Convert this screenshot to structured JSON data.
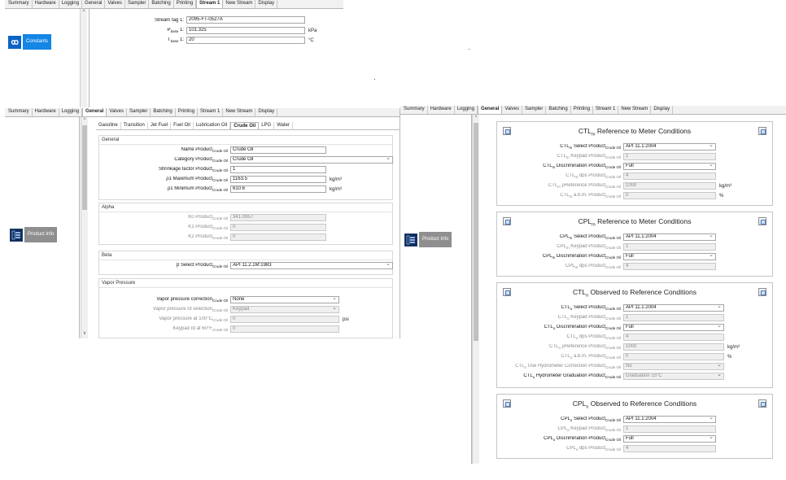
{
  "tabs": [
    "Summary",
    "Hardware",
    "Logging",
    "General",
    "Valves",
    "Sampler",
    "Batching",
    "Printing",
    "Stream 1",
    "New Stream",
    "Display"
  ],
  "top_panel": {
    "active_tab": "Stream 1",
    "tile_label": "Constants",
    "fields": [
      {
        "label": "Stream tag 1:",
        "value": "2095-FT-0527A",
        "unit": ""
      },
      {
        "label_main": "P",
        "label_sub": "base",
        "label_tail": " 1:",
        "value": "101.325",
        "unit": "kPa"
      },
      {
        "label_main": "T",
        "label_sub": "base",
        "label_tail": " 1:",
        "value": "20",
        "unit": "°C"
      }
    ]
  },
  "left_panel": {
    "active_tab": "General",
    "tile_label": "Product Info",
    "product_tabs": [
      "Gasoline",
      "Transition",
      "Jet Fuel",
      "Fuel Oil",
      "Lubrication Oil",
      "Crude Oil",
      "LPG",
      "Water"
    ],
    "active_product_tab": "Crude Oil",
    "general": {
      "title": "General",
      "rows": [
        {
          "label": "Name Product",
          "sub": "Crude Oil",
          "value": "Crude Oil",
          "kind": "input",
          "unit": ""
        },
        {
          "label": "Category Product",
          "sub": "Crude Oil",
          "value": "Crude Oil",
          "kind": "select",
          "unit": ""
        },
        {
          "label": "Shrinkage factor Product",
          "sub": "Crude Oil",
          "value": "1",
          "kind": "input",
          "unit": ""
        },
        {
          "label": "ρ1 Maximum Product",
          "sub": "Crude Oil",
          "value": "1163.5",
          "kind": "input",
          "unit": "kg/m³"
        },
        {
          "label": "ρ1 Minimum Product",
          "sub": "Crude Oil",
          "value": "610.6",
          "kind": "input",
          "unit": "kg/m³"
        }
      ]
    },
    "alpha": {
      "title": "Alpha",
      "rows": [
        {
          "label": "K0 Product",
          "sub": "Crude Oil",
          "value": "341.0957"
        },
        {
          "label": "K1 Product",
          "sub": "Crude Oil",
          "value": "0"
        },
        {
          "label": "K2 Product",
          "sub": "Crude Oil",
          "value": "0"
        }
      ]
    },
    "beta": {
      "title": "Beta",
      "label": "β Select Product",
      "sub": "Crude Oil",
      "value": "API 11.2.1M:1983"
    },
    "vapor": {
      "title": "Vapor Pressure",
      "rows": [
        {
          "label": "Vapor pressure correction",
          "sub": "Crude Oil",
          "value": "None",
          "kind": "select",
          "dim": false,
          "unit": ""
        },
        {
          "label": "Vapor pressure rd selection",
          "sub": "Crude Oil",
          "value": "Keypad",
          "kind": "select-dis",
          "dim": true,
          "unit": ""
        },
        {
          "label": "Vapor pressure at 100°C",
          "sub": "Crude Oil",
          "value": "0",
          "kind": "input-dis",
          "dim": true,
          "unit": "psi"
        },
        {
          "label": "Keypad rd at 60°F",
          "sub": "Crude Oil",
          "value": "0",
          "kind": "input-dis",
          "dim": true,
          "unit": ""
        }
      ]
    }
  },
  "right_panel": {
    "active_tab": "General",
    "tile_label": "Product Info",
    "cards": [
      {
        "title_main": "CTL",
        "title_sub": "m",
        "title_tail": " Reference to Meter Conditions",
        "rows": [
          {
            "pre": "CTL",
            "psub": "m",
            "label": " Select Product",
            "sub": "Crude Oil",
            "value": "API 11.1:2004",
            "kind": "select",
            "dim": false,
            "unit": ""
          },
          {
            "pre": "CTL",
            "psub": "m",
            "label": " Keypad Product",
            "sub": "Crude Oil",
            "value": "1",
            "kind": "input-dis",
            "dim": true,
            "unit": ""
          },
          {
            "pre": "CTL",
            "psub": "m",
            "label": " Discrimination Product",
            "sub": "Crude Oil",
            "value": "Full",
            "kind": "select",
            "dim": false,
            "unit": ""
          },
          {
            "pre": "CTL",
            "psub": "m",
            "label": " dps Product",
            "sub": "Crude Oil",
            "value": "4",
            "kind": "input-dis",
            "dim": true,
            "unit": ""
          },
          {
            "pre": "CTL",
            "psub": "m",
            "label": " ρReference Product",
            "sub": "Crude Oil",
            "value": "1000",
            "kind": "input-dis",
            "dim": true,
            "unit": "kg/m³"
          },
          {
            "pre": "CTL",
            "psub": "m",
            "label": " a.b.m. Product",
            "sub": "Crude Oil",
            "value": "0",
            "kind": "input-dis",
            "dim": true,
            "unit": "%"
          }
        ]
      },
      {
        "title_main": "CPL",
        "title_sub": "m",
        "title_tail": " Reference to Meter Conditions",
        "rows": [
          {
            "pre": "CPL",
            "psub": "m",
            "label": " Select Product",
            "sub": "Crude Oil",
            "value": "API 11.1:2004",
            "kind": "select",
            "dim": false,
            "unit": ""
          },
          {
            "pre": "CPL",
            "psub": "m",
            "label": " Keypad Product",
            "sub": "Crude Oil",
            "value": "1",
            "kind": "input-dis",
            "dim": true,
            "unit": ""
          },
          {
            "pre": "CPL",
            "psub": "m",
            "label": " Discrimination Product",
            "sub": "Crude Oil",
            "value": "Full",
            "kind": "select",
            "dim": false,
            "unit": ""
          },
          {
            "pre": "CPL",
            "psub": "m",
            "label": " dps Product",
            "sub": "Crude Oil",
            "value": "4",
            "kind": "input-dis",
            "dim": true,
            "unit": ""
          }
        ]
      },
      {
        "title_main": "CTL",
        "title_sub": "o",
        "title_tail": " Observed to Reference Conditions",
        "rows": [
          {
            "pre": "CTL",
            "psub": "o",
            "label": " Select Product",
            "sub": "Crude Oil",
            "value": "API 11.1:2004",
            "kind": "select",
            "dim": false,
            "unit": ""
          },
          {
            "pre": "CTL",
            "psub": "o",
            "label": " Keypad Product",
            "sub": "Crude Oil",
            "value": "1",
            "kind": "input-dis",
            "dim": true,
            "unit": ""
          },
          {
            "pre": "CTL",
            "psub": "o",
            "label": " Discrimination Product",
            "sub": "Crude Oil",
            "value": "Full",
            "kind": "select",
            "dim": false,
            "unit": ""
          },
          {
            "pre": "CTL",
            "psub": "o",
            "label": " dps Product",
            "sub": "Crude Oil",
            "value": "4",
            "kind": "input-dis",
            "dim": true,
            "unit": ""
          },
          {
            "pre": "CTL",
            "psub": "o",
            "label": " ρReference Product",
            "sub": "Crude Oil",
            "value": "1000",
            "kind": "input-dis",
            "dim": true,
            "unit": "kg/m³"
          },
          {
            "pre": "CTL",
            "psub": "o",
            "label": " a.b.m. Product",
            "sub": "Crude Oil",
            "value": "0",
            "kind": "input-dis",
            "dim": true,
            "unit": "%"
          },
          {
            "pre": "CTL",
            "psub": "o",
            "label": " Use Hydrometer Correction Product",
            "sub": "Crude Oil",
            "value": "No",
            "kind": "select-dis",
            "dim": true,
            "unit": ""
          },
          {
            "pre": "CTL",
            "psub": "o",
            "label": " Hydrometer Graduation Product",
            "sub": "Crude Oil",
            "value": "Graduation 15°C",
            "kind": "select-dis",
            "dim": false,
            "unit": ""
          }
        ]
      },
      {
        "title_main": "CPL",
        "title_sub": "o",
        "title_tail": " Observed to Reference Conditions",
        "rows": [
          {
            "pre": "CPL",
            "psub": "o",
            "label": " Select Product",
            "sub": "Crude Oil",
            "value": "API 11.1:2004",
            "kind": "select",
            "dim": false,
            "unit": ""
          },
          {
            "pre": "CPL",
            "psub": "o",
            "label": " Keypad Product",
            "sub": "Crude Oil",
            "value": "1",
            "kind": "input-dis",
            "dim": true,
            "unit": ""
          },
          {
            "pre": "CPL",
            "psub": "o",
            "label": " Discrimination Product",
            "sub": "Crude Oil",
            "value": "Full",
            "kind": "select",
            "dim": false,
            "unit": ""
          },
          {
            "pre": "CPL",
            "psub": "o",
            "label": " dps Product",
            "sub": "Crude Oil",
            "value": "4",
            "kind": "input-dis",
            "dim": true,
            "unit": ""
          }
        ]
      }
    ]
  }
}
